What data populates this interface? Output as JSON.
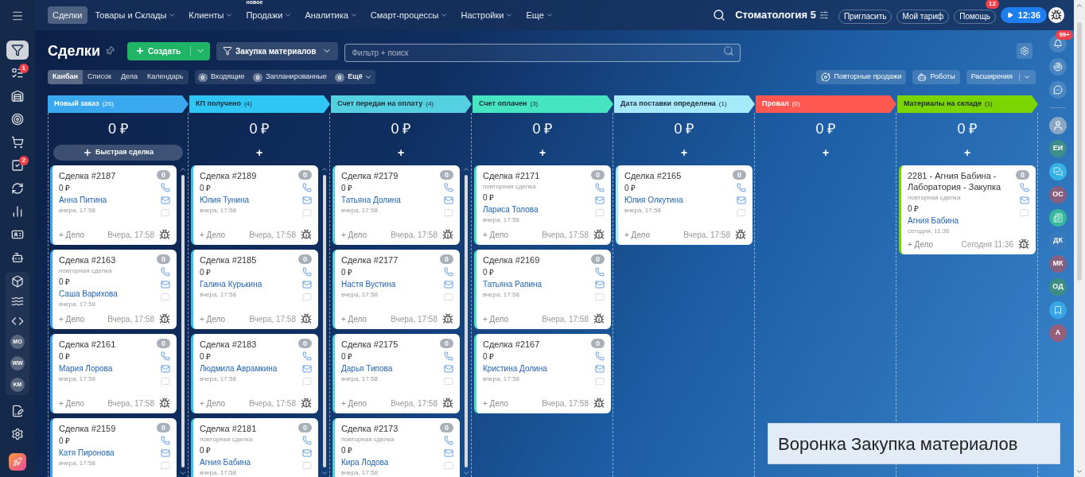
{
  "top_nav": {
    "items": [
      {
        "label": "Сделки",
        "selected": true,
        "dropdown": false
      },
      {
        "label": "Товары и Склады",
        "selected": false,
        "dropdown": true
      },
      {
        "label": "Клиенты",
        "selected": false,
        "dropdown": true
      },
      {
        "label": "Продажи",
        "selected": false,
        "dropdown": true,
        "tag": "новое"
      },
      {
        "label": "Аналитика",
        "selected": false,
        "dropdown": true
      },
      {
        "label": "Смарт-процессы",
        "selected": false,
        "dropdown": true
      },
      {
        "label": "Настройки",
        "selected": false,
        "dropdown": true
      },
      {
        "label": "Еще",
        "selected": false,
        "dropdown": true
      }
    ],
    "portal": "Стоматология 5",
    "buttons": [
      {
        "label": "Пригласить"
      },
      {
        "label": "Мой тариф"
      },
      {
        "label": "Помощь",
        "badge": "12"
      }
    ],
    "timer": "12:36"
  },
  "left_sidebar": {
    "items": [
      {
        "selected": true
      },
      {
        "selected": false,
        "badge": "1"
      },
      {
        "selected": false
      },
      {
        "selected": false
      },
      {
        "selected": false
      },
      {
        "selected": false,
        "badge": "2"
      },
      {
        "selected": false
      },
      {
        "selected": false
      },
      {
        "selected": false
      },
      {
        "selected": false
      }
    ],
    "group": [
      {
        "kind": "icon"
      },
      {
        "kind": "icon"
      },
      {
        "kind": "icon"
      },
      {
        "kind": "avatar",
        "initials": "MO"
      },
      {
        "kind": "avatar",
        "initials": "WW"
      },
      {
        "kind": "avatar",
        "initials": "KM"
      }
    ]
  },
  "header": {
    "title": "Сделки",
    "create_button": "Создать",
    "funnel": "Закупка материалов",
    "filter": {
      "placeholder": "Фильтр + поиск"
    }
  },
  "view_tabs": [
    {
      "label": "Канбан",
      "selected": true
    },
    {
      "label": "Список",
      "selected": false
    },
    {
      "label": "Дела",
      "selected": false
    },
    {
      "label": "Календарь",
      "selected": false
    }
  ],
  "counters": [
    {
      "count": "0",
      "label": "Входящие",
      "dropdown": false
    },
    {
      "count": "0",
      "label": "Запланированные",
      "dropdown": false
    },
    {
      "count": "0",
      "label": "Ещё",
      "dropdown": true
    }
  ],
  "tools": [
    {
      "label": "Повторные продажи",
      "dropdown": false
    },
    {
      "label": "Роботы",
      "dropdown": false
    },
    {
      "label": "Расширения",
      "dropdown": true
    }
  ],
  "columns": [
    {
      "name": "Новый заказ",
      "count": "(26)",
      "color": "#39a8ef",
      "total": "0 ₽",
      "add": "Быстрая сделка",
      "scrollable": true,
      "cards": [
        {
          "title": "Сделка #2187",
          "amount": "0 ₽",
          "contact": "Анна Питина",
          "created": "вчера, 17:58",
          "counter": "0",
          "action": "+ Дело",
          "activity": "Вчера, 17:58"
        },
        {
          "title": "Сделка #2163",
          "note": "повторная сделка",
          "amount": "0 ₽",
          "contact": "Саша Варихова",
          "created": "вчера, 17:58",
          "counter": "0",
          "action": "+ Дело",
          "activity": "Вчера, 17:58"
        },
        {
          "title": "Сделка #2161",
          "amount": "0 ₽",
          "contact": "Мария Лорова",
          "created": "вчера, 17:58",
          "counter": "0",
          "action": "+ Дело",
          "activity": "Вчера, 17:58"
        },
        {
          "title": "Сделка #2159",
          "amount": "0 ₽",
          "contact": "Катя Пиронова",
          "created": "вчера, 17:58",
          "counter": "0"
        }
      ]
    },
    {
      "name": "КП получено",
      "count": "(4)",
      "color": "#2fc6f6",
      "total": "0 ₽",
      "add": "+",
      "scrollable": true,
      "cards": [
        {
          "title": "Сделка #2189",
          "amount": "0 ₽",
          "contact": "Юлия Тунина",
          "created": "вчера, 17:58",
          "counter": "0",
          "action": "+ Дело",
          "activity": "Вчера, 17:58"
        },
        {
          "title": "Сделка #2185",
          "amount": "0 ₽",
          "contact": "Галина Курькина",
          "created": "вчера, 17:58",
          "counter": "0",
          "action": "+ Дело",
          "activity": "Вчера, 17:58"
        },
        {
          "title": "Сделка #2183",
          "amount": "0 ₽",
          "contact": "Людмила Аврамкина",
          "created": "вчера, 17:58",
          "counter": "0",
          "action": "+ Дело",
          "activity": "Вчера, 17:58"
        },
        {
          "title": "Сделка #2181",
          "note": "повторная сделка",
          "amount": "0 ₽",
          "contact": "Агния Бабина",
          "created": "вчера, 17:58",
          "counter": "0"
        }
      ]
    },
    {
      "name": "Счет передан на оплату",
      "count": "(4)",
      "color": "#55d0e0",
      "total": "0 ₽",
      "add": "+",
      "scrollable": true,
      "cards": [
        {
          "title": "Сделка #2179",
          "amount": "0 ₽",
          "contact": "Татьяна Долина",
          "created": "вчера, 17:58",
          "counter": "0",
          "action": "+ Дело",
          "activity": "Вчера, 17:58"
        },
        {
          "title": "Сделка #2177",
          "amount": "0 ₽",
          "contact": "Настя Вустина",
          "created": "вчера, 17:58",
          "counter": "0",
          "action": "+ Дело",
          "activity": "Вчера, 17:58"
        },
        {
          "title": "Сделка #2175",
          "amount": "0 ₽",
          "contact": "Дарья Типова",
          "created": "вчера, 17:58",
          "counter": "0",
          "action": "+ Дело",
          "activity": "Вчера, 17:58"
        },
        {
          "title": "Сделка #2173",
          "note": "повторная сделка",
          "amount": "0 ₽",
          "contact": "Кира Лодова",
          "created": "вчера, 17:58",
          "counter": "0"
        }
      ]
    },
    {
      "name": "Счет оплачен",
      "count": "(3)",
      "color": "#47e4c2",
      "total": "0 ₽",
      "add": "+",
      "scrollable": false,
      "cards": [
        {
          "title": "Сделка #2171",
          "note": "повторная сделка",
          "amount": "0 ₽",
          "contact": "Лариса Толова",
          "created": "вчера, 17:58",
          "counter": "0",
          "action": "+ Дело",
          "activity": "Вчера, 17:58"
        },
        {
          "title": "Сделка #2169",
          "amount": "0 ₽",
          "contact": "Татьяна Рапина",
          "created": "вчера, 17:58",
          "counter": "0",
          "action": "+ Дело",
          "activity": "Вчера, 17:58"
        },
        {
          "title": "Сделка #2167",
          "amount": "0 ₽",
          "contact": "Кристина Долина",
          "created": "вчера, 17:58",
          "counter": "0",
          "action": "+ Дело",
          "activity": "Вчера, 17:58"
        }
      ]
    },
    {
      "name": "Дата поставки определена",
      "count": "(1)",
      "color": "#a5e9fa",
      "total": "0 ₽",
      "add": "+",
      "scrollable": false,
      "cards": [
        {
          "title": "Сделка #2165",
          "amount": "0 ₽",
          "contact": "Юлия Олкутина",
          "created": "вчера, 17:58",
          "counter": "0",
          "action": "+ Дело",
          "activity": "Вчера, 17:58"
        }
      ]
    },
    {
      "name": "Провал",
      "count": "(0)",
      "color": "#ff5752",
      "total": "0 ₽",
      "add": "+",
      "scrollable": false
    },
    {
      "name": "Материалы на складе",
      "count": "(1)",
      "color": "#7bd500",
      "total": "0 ₽",
      "add": "+",
      "scrollable": false,
      "cards": [
        {
          "title": "2281 - Агния Бабина - Лаборатория - Закупка",
          "note": "повторная сделка",
          "amount": "0 ₽",
          "contact": "Агния Бабина",
          "created": "сегодня, 11:36",
          "counter": "0",
          "action": "+ Дело",
          "activity": "Сегодня 11:36"
        }
      ]
    }
  ],
  "right_sidebar": {
    "bell_badge": "99+",
    "items": [
      {
        "kind": "photo"
      },
      {
        "kind": "initials",
        "initials": "ЕИ",
        "color": "#3d8e8a"
      },
      {
        "kind": "chat",
        "color": "#35b2e6"
      },
      {
        "kind": "initials",
        "initials": "ОС",
        "color": "#86607e"
      },
      {
        "kind": "news",
        "color": "#36b89c"
      },
      {
        "kind": "initials",
        "initials": "ДК",
        "color": "#3a7bbd"
      },
      {
        "kind": "initials",
        "initials": "МК",
        "color": "#86607e"
      },
      {
        "kind": "initials",
        "initials": "ОД",
        "color": "#3d8e80"
      },
      {
        "kind": "bookmark",
        "color": "#36a6e6"
      },
      {
        "kind": "initials",
        "initials": "А",
        "color": "#96607a"
      }
    ]
  },
  "caption": "Воронка Закупка материалов"
}
